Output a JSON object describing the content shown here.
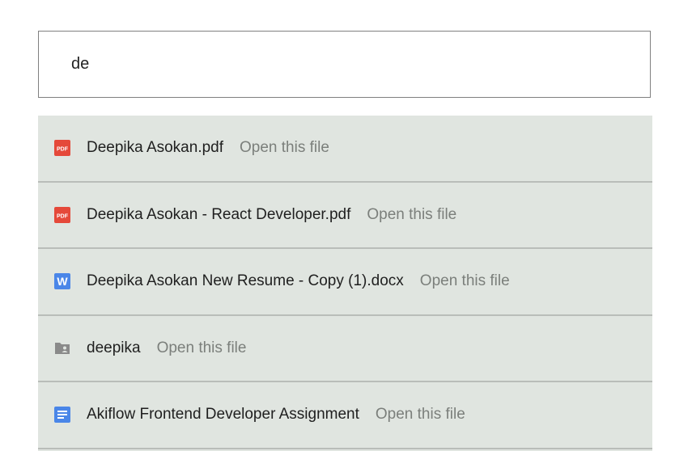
{
  "search": {
    "value": "de"
  },
  "results": [
    {
      "name": "Deepika Asokan.pdf",
      "hint": "Open this file",
      "icon": "pdf-icon",
      "color": "#e5493a"
    },
    {
      "name": "Deepika Asokan - React Developer.pdf",
      "hint": "Open this file",
      "icon": "pdf-icon",
      "color": "#e5493a"
    },
    {
      "name": "Deepika Asokan New Resume - Copy (1).docx",
      "hint": "Open this file",
      "icon": "word-doc-icon",
      "color": "#4a86e8"
    },
    {
      "name": "deepika",
      "hint": "Open this file",
      "icon": "shared-folder-icon",
      "color": "#8a8a8a"
    },
    {
      "name": "Akiflow Frontend Developer Assignment",
      "hint": "Open this file",
      "icon": "google-doc-icon",
      "color": "#4a86e8"
    }
  ]
}
